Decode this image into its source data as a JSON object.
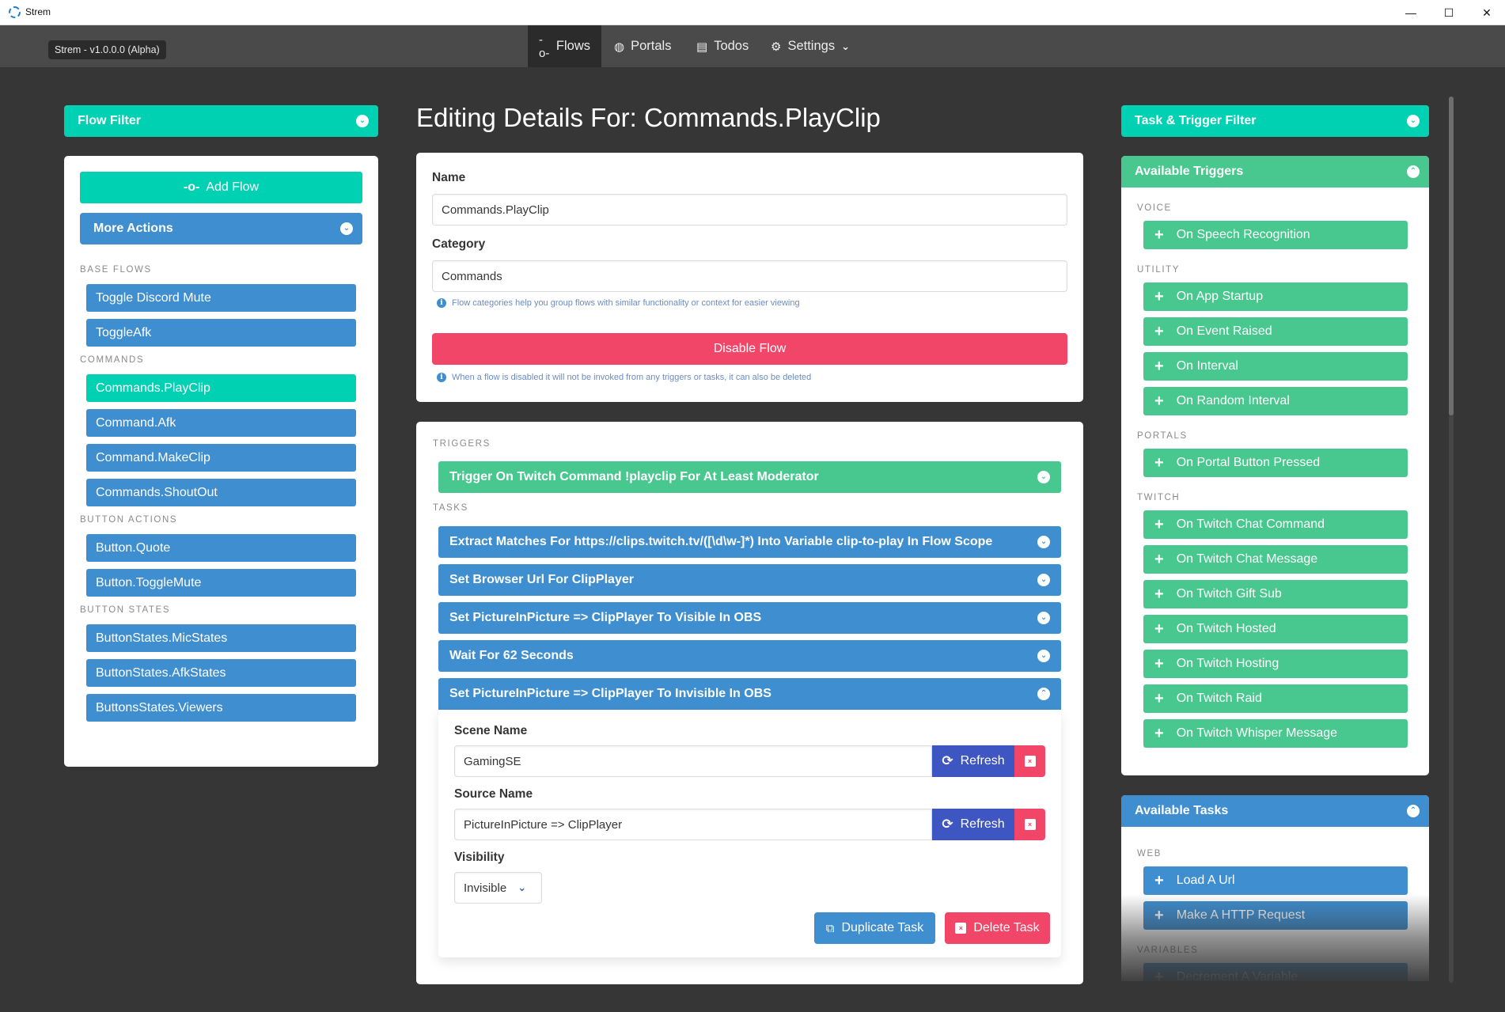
{
  "window": {
    "title": "Strem",
    "controls": {
      "minimize": "—",
      "maximize": "☐",
      "close": "✕"
    }
  },
  "nav": {
    "version": "Strem - v1.0.0.0 (Alpha)",
    "items": [
      {
        "label": "Flows",
        "icon": "flow-icon",
        "glyph": "-o-",
        "active": true
      },
      {
        "label": "Portals",
        "icon": "globe-icon",
        "glyph": "◍",
        "active": false
      },
      {
        "label": "Todos",
        "icon": "clipboard-icon",
        "glyph": "▤",
        "active": false
      },
      {
        "label": "Settings",
        "icon": "gears-icon",
        "glyph": "⚙",
        "active": false,
        "dropdown": "⌄"
      }
    ]
  },
  "left": {
    "filter_label": "Flow Filter",
    "add_flow_label": "Add Flow",
    "add_flow_glyph": "-o-",
    "more_actions_label": "More Actions",
    "groups": [
      {
        "label": "BASE FLOWS",
        "items": [
          "Toggle Discord Mute",
          "ToggleAfk"
        ]
      },
      {
        "label": "COMMANDS",
        "items": [
          "Commands.PlayClip",
          "Command.Afk",
          "Command.MakeClip",
          "Commands.ShoutOut"
        ]
      },
      {
        "label": "BUTTON ACTIONS",
        "items": [
          "Button.Quote",
          "Button.ToggleMute"
        ]
      },
      {
        "label": "BUTTON STATES",
        "items": [
          "ButtonStates.MicStates",
          "ButtonStates.AfkStates",
          "ButtonsStates.Viewers"
        ]
      }
    ],
    "selected": "Commands.PlayClip"
  },
  "center": {
    "title": "Editing Details For: Commands.PlayClip",
    "name_label": "Name",
    "name_value": "Commands.PlayClip",
    "category_label": "Category",
    "category_value": "Commands",
    "category_help": "Flow categories help you group flows with similar functionality or context for easier viewing",
    "disable_label": "Disable Flow",
    "disable_help": "When a flow is disabled it will not be invoked from any triggers or tasks, it can also be deleted",
    "triggers_label": "TRIGGERS",
    "triggers": [
      {
        "label": "Trigger On Twitch Command !playclip For At Least Moderator",
        "expanded": false
      }
    ],
    "tasks_label": "TASKS",
    "tasks": [
      {
        "label": "Extract Matches For https://clips.twitch.tv/([\\d\\w-]*) Into Variable clip-to-play In Flow Scope",
        "expanded": false
      },
      {
        "label": "Set Browser Url For ClipPlayer",
        "expanded": false
      },
      {
        "label": "Set PictureInPicture => ClipPlayer To Visible In OBS",
        "expanded": false
      },
      {
        "label": "Wait For 62 Seconds",
        "expanded": false
      },
      {
        "label": "Set PictureInPicture => ClipPlayer To Invisible In OBS",
        "expanded": true
      }
    ],
    "expanded_task": {
      "scene_label": "Scene Name",
      "scene_value": "GamingSE",
      "source_label": "Source Name",
      "source_value": "PictureInPicture => ClipPlayer",
      "refresh_label": "Refresh",
      "visibility_label": "Visibility",
      "visibility_value": "Invisible",
      "duplicate_label": "Duplicate Task",
      "delete_label": "Delete Task"
    }
  },
  "right": {
    "filter_label": "Task & Trigger Filter",
    "triggers_title": "Available Triggers",
    "trigger_groups": [
      {
        "label": "VOICE",
        "items": [
          "On Speech Recognition"
        ]
      },
      {
        "label": "UTILITY",
        "items": [
          "On App Startup",
          "On Event Raised",
          "On Interval",
          "On Random Interval"
        ]
      },
      {
        "label": "PORTALS",
        "items": [
          "On Portal Button Pressed"
        ]
      },
      {
        "label": "TWITCH",
        "items": [
          "On Twitch Chat Command",
          "On Twitch Chat Message",
          "On Twitch Gift Sub",
          "On Twitch Hosted",
          "On Twitch Hosting",
          "On Twitch Raid",
          "On Twitch Whisper Message"
        ]
      }
    ],
    "tasks_title": "Available Tasks",
    "task_groups": [
      {
        "label": "WEB",
        "items": [
          "Load A Url",
          "Make A HTTP Request"
        ]
      },
      {
        "label": "VARIABLES",
        "items": [
          "Decrement A Variable"
        ]
      }
    ]
  },
  "colors": {
    "teal": "#00d1b2",
    "blue": "#3e8ed0",
    "green": "#48c78e",
    "red": "#f14668",
    "indigo": "#3d56c2",
    "background": "#363636",
    "navbar": "#4a4a4a"
  }
}
